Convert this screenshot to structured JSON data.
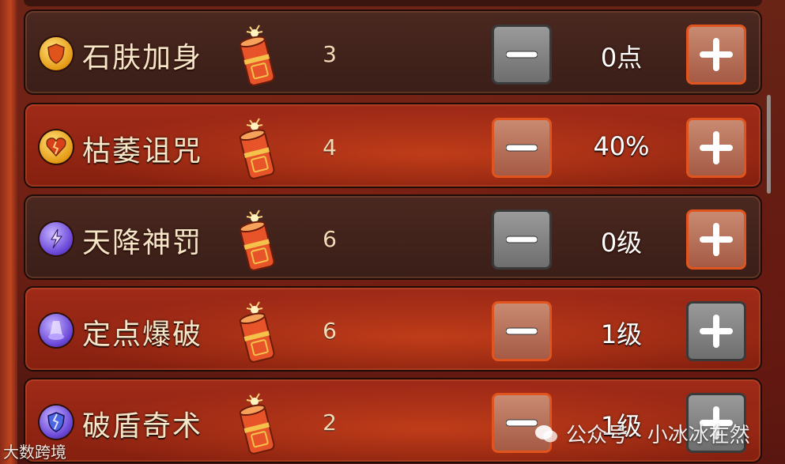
{
  "skills": [
    {
      "name": "石肤加身",
      "cost": "3",
      "value": "0点",
      "icon": "shield-icon",
      "icon_color": "gold",
      "row_style": "dark",
      "minus_style": "grey",
      "plus_style": "orange"
    },
    {
      "name": "枯萎诅咒",
      "cost": "4",
      "value": "40%",
      "icon": "broken-heart-icon",
      "icon_color": "gold",
      "row_style": "red",
      "minus_style": "orange",
      "plus_style": "orange"
    },
    {
      "name": "天降神罚",
      "cost": "6",
      "value": "0级",
      "icon": "lightning-icon",
      "icon_color": "purple",
      "row_style": "dark",
      "minus_style": "grey",
      "plus_style": "orange"
    },
    {
      "name": "定点爆破",
      "cost": "6",
      "value": "1级",
      "icon": "beam-icon",
      "icon_color": "purple",
      "row_style": "red",
      "minus_style": "orange",
      "plus_style": "grey"
    },
    {
      "name": "破盾奇术",
      "cost": "2",
      "value": "1级",
      "icon": "cracked-shield-icon",
      "icon_color": "purple",
      "row_style": "red",
      "minus_style": "orange",
      "plus_style": "grey"
    }
  ],
  "currency_icon": "firecracker-icon",
  "watermark": {
    "left": "大数跨境",
    "right": "公众号 · 小冰冰在然"
  }
}
